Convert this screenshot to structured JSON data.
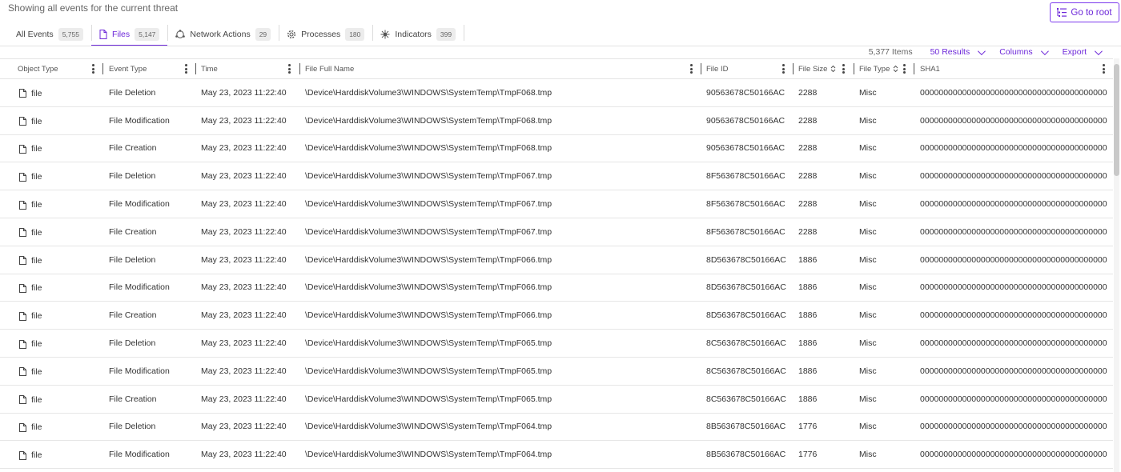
{
  "header_text": "Showing all events for the current threat",
  "go_root_label": "Go to root",
  "tabs": [
    {
      "label": "All Events",
      "count": "5,755",
      "icon": "none"
    },
    {
      "label": "Files",
      "count": "5,147",
      "icon": "file-icon"
    },
    {
      "label": "Network Actions",
      "count": "29",
      "icon": "network-icon"
    },
    {
      "label": "Processes",
      "count": "180",
      "icon": "gear-icon"
    },
    {
      "label": "Indicators",
      "count": "399",
      "icon": "virus-icon"
    }
  ],
  "toolbar": {
    "items_count": "5,377 Items",
    "results": "50 Results",
    "columns": "Columns",
    "export": "Export"
  },
  "columns": [
    "Object Type",
    "Event Type",
    "Time",
    "File Full Name",
    "File ID",
    "File Size",
    "File Type",
    "SHA1"
  ],
  "rows": [
    {
      "object": "file",
      "event": "File Deletion",
      "time": "May 23, 2023 11:22:40",
      "name": "\\Device\\HarddiskVolume3\\WINDOWS\\SystemTemp\\TmpF068.tmp",
      "id": "90563678C50166AC",
      "size": "2288",
      "type": "Misc",
      "sha1": "0000000000000000000000000000000000000000"
    },
    {
      "object": "file",
      "event": "File Modification",
      "time": "May 23, 2023 11:22:40",
      "name": "\\Device\\HarddiskVolume3\\WINDOWS\\SystemTemp\\TmpF068.tmp",
      "id": "90563678C50166AC",
      "size": "2288",
      "type": "Misc",
      "sha1": "0000000000000000000000000000000000000000"
    },
    {
      "object": "file",
      "event": "File Creation",
      "time": "May 23, 2023 11:22:40",
      "name": "\\Device\\HarddiskVolume3\\WINDOWS\\SystemTemp\\TmpF068.tmp",
      "id": "90563678C50166AC",
      "size": "2288",
      "type": "Misc",
      "sha1": "0000000000000000000000000000000000000000"
    },
    {
      "object": "file",
      "event": "File Deletion",
      "time": "May 23, 2023 11:22:40",
      "name": "\\Device\\HarddiskVolume3\\WINDOWS\\SystemTemp\\TmpF067.tmp",
      "id": "8F563678C50166AC",
      "size": "2288",
      "type": "Misc",
      "sha1": "0000000000000000000000000000000000000000"
    },
    {
      "object": "file",
      "event": "File Modification",
      "time": "May 23, 2023 11:22:40",
      "name": "\\Device\\HarddiskVolume3\\WINDOWS\\SystemTemp\\TmpF067.tmp",
      "id": "8F563678C50166AC",
      "size": "2288",
      "type": "Misc",
      "sha1": "0000000000000000000000000000000000000000"
    },
    {
      "object": "file",
      "event": "File Creation",
      "time": "May 23, 2023 11:22:40",
      "name": "\\Device\\HarddiskVolume3\\WINDOWS\\SystemTemp\\TmpF067.tmp",
      "id": "8F563678C50166AC",
      "size": "2288",
      "type": "Misc",
      "sha1": "0000000000000000000000000000000000000000"
    },
    {
      "object": "file",
      "event": "File Deletion",
      "time": "May 23, 2023 11:22:40",
      "name": "\\Device\\HarddiskVolume3\\WINDOWS\\SystemTemp\\TmpF066.tmp",
      "id": "8D563678C50166AC",
      "size": "1886",
      "type": "Misc",
      "sha1": "0000000000000000000000000000000000000000"
    },
    {
      "object": "file",
      "event": "File Modification",
      "time": "May 23, 2023 11:22:40",
      "name": "\\Device\\HarddiskVolume3\\WINDOWS\\SystemTemp\\TmpF066.tmp",
      "id": "8D563678C50166AC",
      "size": "1886",
      "type": "Misc",
      "sha1": "0000000000000000000000000000000000000000"
    },
    {
      "object": "file",
      "event": "File Creation",
      "time": "May 23, 2023 11:22:40",
      "name": "\\Device\\HarddiskVolume3\\WINDOWS\\SystemTemp\\TmpF066.tmp",
      "id": "8D563678C50166AC",
      "size": "1886",
      "type": "Misc",
      "sha1": "0000000000000000000000000000000000000000"
    },
    {
      "object": "file",
      "event": "File Deletion",
      "time": "May 23, 2023 11:22:40",
      "name": "\\Device\\HarddiskVolume3\\WINDOWS\\SystemTemp\\TmpF065.tmp",
      "id": "8C563678C50166AC",
      "size": "1886",
      "type": "Misc",
      "sha1": "0000000000000000000000000000000000000000"
    },
    {
      "object": "file",
      "event": "File Modification",
      "time": "May 23, 2023 11:22:40",
      "name": "\\Device\\HarddiskVolume3\\WINDOWS\\SystemTemp\\TmpF065.tmp",
      "id": "8C563678C50166AC",
      "size": "1886",
      "type": "Misc",
      "sha1": "0000000000000000000000000000000000000000"
    },
    {
      "object": "file",
      "event": "File Creation",
      "time": "May 23, 2023 11:22:40",
      "name": "\\Device\\HarddiskVolume3\\WINDOWS\\SystemTemp\\TmpF065.tmp",
      "id": "8C563678C50166AC",
      "size": "1886",
      "type": "Misc",
      "sha1": "0000000000000000000000000000000000000000"
    },
    {
      "object": "file",
      "event": "File Deletion",
      "time": "May 23, 2023 11:22:40",
      "name": "\\Device\\HarddiskVolume3\\WINDOWS\\SystemTemp\\TmpF064.tmp",
      "id": "8B563678C50166AC",
      "size": "1776",
      "type": "Misc",
      "sha1": "0000000000000000000000000000000000000000"
    },
    {
      "object": "file",
      "event": "File Modification",
      "time": "May 23, 2023 11:22:40",
      "name": "\\Device\\HarddiskVolume3\\WINDOWS\\SystemTemp\\TmpF064.tmp",
      "id": "8B563678C50166AC",
      "size": "1776",
      "type": "Misc",
      "sha1": "0000000000000000000000000000000000000000"
    }
  ],
  "colors": {
    "accent": "#6d28d9",
    "border": "#e4e4e4",
    "badge_bg": "#ececec"
  }
}
